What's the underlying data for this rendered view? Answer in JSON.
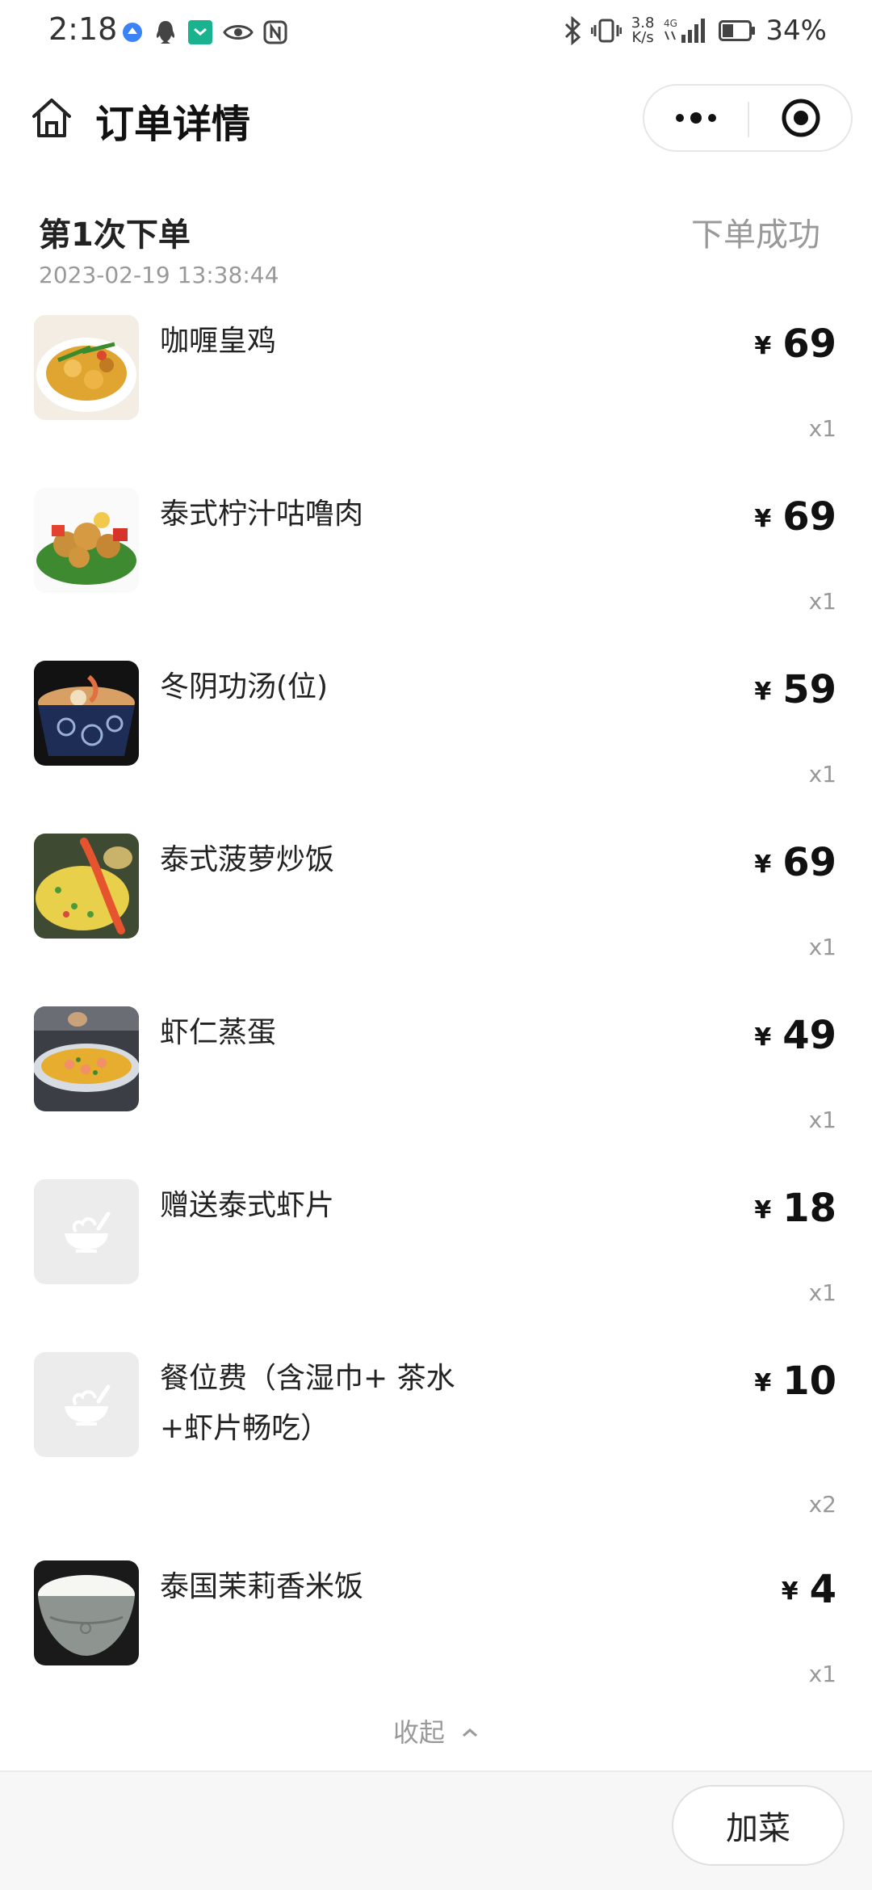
{
  "status_bar": {
    "time": "2:18",
    "network_speed_top": "3.8",
    "network_speed_bottom": "K/s",
    "network_type": "4G",
    "battery": "34%"
  },
  "header": {
    "title": "订单详情"
  },
  "order": {
    "title": "第1次下单",
    "status": "下单成功",
    "time": "2023-02-19 13:38:44",
    "currency": "¥",
    "items": [
      {
        "name": "咖喱皇鸡",
        "price": "69",
        "qty": "x1",
        "image": "curry-chicken"
      },
      {
        "name": "泰式柠汁咕噜肉",
        "price": "69",
        "qty": "x1",
        "image": "sweet-sour-pork"
      },
      {
        "name": "冬阴功汤(位)",
        "price": "59",
        "qty": "x1",
        "image": "tom-yum-soup"
      },
      {
        "name": "泰式菠萝炒饭",
        "price": "69",
        "qty": "x1",
        "image": "pineapple-fried-rice"
      },
      {
        "name": "虾仁蒸蛋",
        "price": "49",
        "qty": "x1",
        "image": "shrimp-steamed-egg"
      },
      {
        "name": "赠送泰式虾片",
        "price": "18",
        "qty": "x1",
        "image": "placeholder"
      },
      {
        "name": "餐位费（含湿巾+ 茶水+虾片畅吃）",
        "price": "10",
        "qty": "x2",
        "image": "placeholder"
      },
      {
        "name": "泰国茉莉香米饭",
        "price": "4",
        "qty": "x1",
        "image": "jasmine-rice"
      }
    ]
  },
  "collapse_label": "收起",
  "bottom": {
    "add_dish_label": "加菜"
  }
}
